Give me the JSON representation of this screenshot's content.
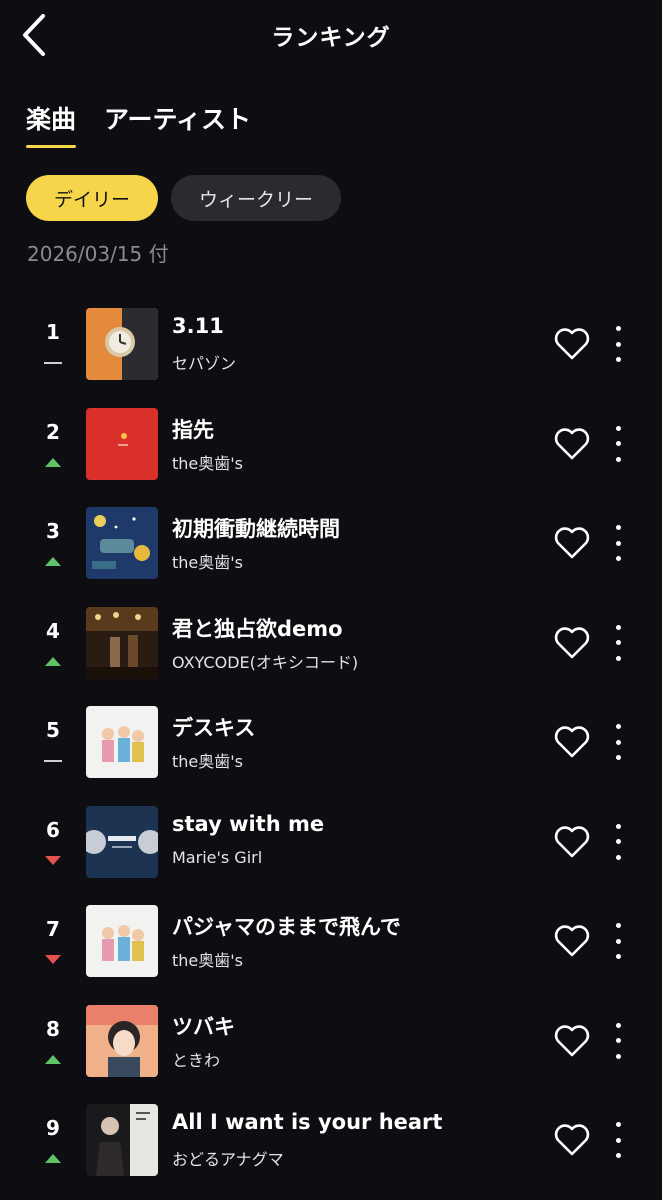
{
  "header": {
    "title": "ランキング",
    "back_icon": "chevron-left-icon"
  },
  "tabs": [
    {
      "label": "楽曲",
      "active": true
    },
    {
      "label": "アーティスト",
      "active": false
    }
  ],
  "periods": [
    {
      "label": "デイリー",
      "active": true
    },
    {
      "label": "ウィークリー",
      "active": false
    }
  ],
  "date_label": "2026/03/15 付",
  "colors": {
    "accent": "#f7d54b",
    "background": "#0d0d12",
    "trend_up": "#5fc36a",
    "trend_down": "#e5524f"
  },
  "ranking": [
    {
      "rank": "1",
      "trend": "same",
      "title": "3.11",
      "artist": "セパゾン"
    },
    {
      "rank": "2",
      "trend": "up",
      "title": "指先",
      "artist": "the奥歯's"
    },
    {
      "rank": "3",
      "trend": "up",
      "title": "初期衝動継続時間",
      "artist": "the奥歯's"
    },
    {
      "rank": "4",
      "trend": "up",
      "title": "君と独占欲demo",
      "artist": "OXYCODE(オキシコード)"
    },
    {
      "rank": "5",
      "trend": "same",
      "title": "デスキス",
      "artist": "the奥歯's"
    },
    {
      "rank": "6",
      "trend": "down",
      "title": "stay with me",
      "artist": "Marie's Girl"
    },
    {
      "rank": "7",
      "trend": "down",
      "title": "パジャマのままで飛んで",
      "artist": "the奥歯's"
    },
    {
      "rank": "8",
      "trend": "up",
      "title": "ツバキ",
      "artist": "ときわ"
    },
    {
      "rank": "9",
      "trend": "up",
      "title": "All I want is your heart",
      "artist": "おどるアナグマ"
    }
  ]
}
